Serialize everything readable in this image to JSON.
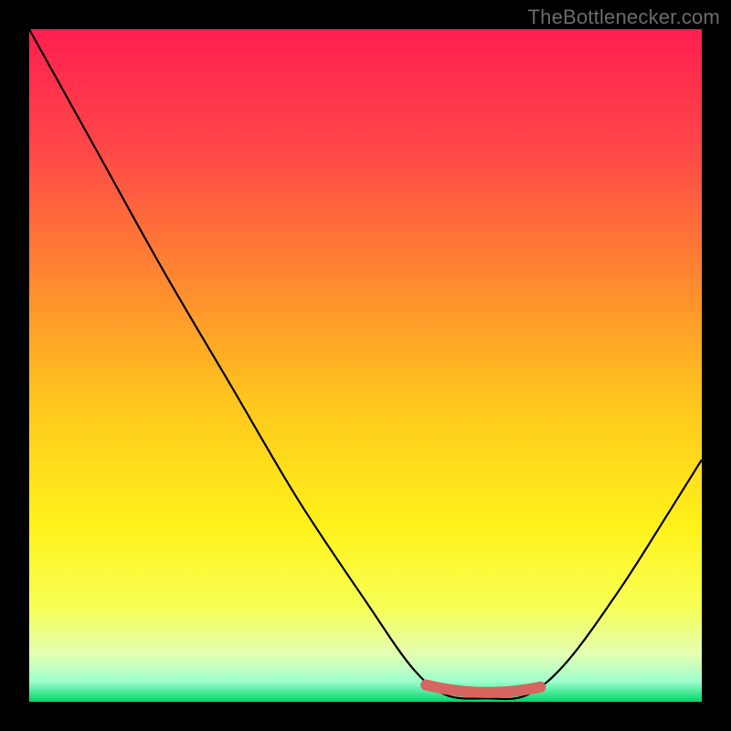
{
  "watermark": "TheBottlenecker.com",
  "chart_data": {
    "type": "line",
    "title": "",
    "xlabel": "",
    "ylabel": "",
    "xlim": [
      0,
      100
    ],
    "ylim": [
      0,
      100
    ],
    "grid": false,
    "legend": false,
    "background_gradient": [
      {
        "stop": 0.0,
        "color": "#ff1f4f"
      },
      {
        "stop": 0.18,
        "color": "#ff4848"
      },
      {
        "stop": 0.38,
        "color": "#ff8b2f"
      },
      {
        "stop": 0.56,
        "color": "#ffc81d"
      },
      {
        "stop": 0.74,
        "color": "#fff21a"
      },
      {
        "stop": 0.86,
        "color": "#f7ff56"
      },
      {
        "stop": 0.93,
        "color": "#e3ffb4"
      },
      {
        "stop": 0.97,
        "color": "#9dffce"
      },
      {
        "stop": 1.0,
        "color": "#00d66a"
      }
    ],
    "series": [
      {
        "name": "bottleneck-curve",
        "points": [
          {
            "x": 0,
            "y": 100
          },
          {
            "x": 10,
            "y": 82
          },
          {
            "x": 20,
            "y": 64
          },
          {
            "x": 30,
            "y": 47
          },
          {
            "x": 40,
            "y": 30
          },
          {
            "x": 50,
            "y": 15
          },
          {
            "x": 57,
            "y": 5
          },
          {
            "x": 62,
            "y": 1
          },
          {
            "x": 68,
            "y": 0.5
          },
          {
            "x": 74,
            "y": 1
          },
          {
            "x": 80,
            "y": 6
          },
          {
            "x": 88,
            "y": 17
          },
          {
            "x": 95,
            "y": 28
          },
          {
            "x": 100,
            "y": 36
          }
        ]
      },
      {
        "name": "highlight-segment",
        "x_range": [
          59,
          76
        ],
        "y": 1,
        "color": "#d6655f",
        "thickness": 12
      }
    ]
  }
}
